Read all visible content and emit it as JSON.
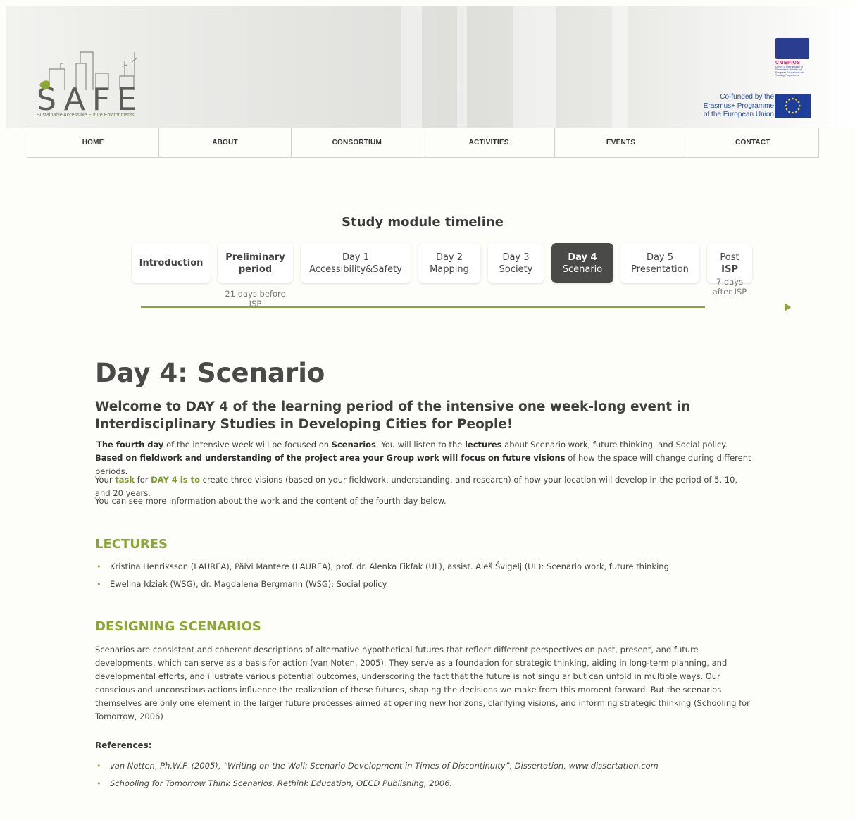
{
  "brand": {
    "logo_text": "SAFE",
    "logo_subtitle": "Sustainable  Accessible  Future  Environments",
    "cmepius_name": "CMEPIUS",
    "cmepius_desc": "Centre of the Republic of Slovenia for Mobility and European Educational and Training Programmes",
    "cofunded_line1": "Co-funded by the",
    "cofunded_line2": "Erasmus+ Programme",
    "cofunded_line3": "of the European Union"
  },
  "nav": {
    "items": [
      {
        "label": "HOME"
      },
      {
        "label": "ABOUT"
      },
      {
        "label": "CONSORTIUM"
      },
      {
        "label": "ACTIVITIES"
      },
      {
        "label": "EVENTS"
      },
      {
        "label": "CONTACT"
      }
    ]
  },
  "timeline": {
    "title": "Study module timeline",
    "steps": [
      {
        "line1": "Introduction",
        "line2": ""
      },
      {
        "line1": "Preliminary",
        "line2": "period"
      },
      {
        "line1": "Day 1",
        "line2": "Accessibility&Safety"
      },
      {
        "line1": "Day 2",
        "line2": "Mapping"
      },
      {
        "line1": "Day 3",
        "line2": "Society"
      },
      {
        "line1": "Day 4",
        "line2": "Scenario"
      },
      {
        "line1": "Day 5",
        "line2": "Presentation"
      },
      {
        "line1": "Post",
        "line2": "ISP"
      }
    ],
    "note_before": "21 days before ISP",
    "note_after_1": "7 days",
    "note_after_2": "after ISP"
  },
  "main": {
    "title": "Day 4: Scenario",
    "welcome": "Welcome to DAY 4 of the learning period of the intensive one week-long event in Interdisciplinary Studies in Developing Cities for People!",
    "intro": {
      "b1": "The fourth day",
      "t1": " of the intensive week will be focused on ",
      "b2": "Scenarios",
      "t2": ". You will listen to the ",
      "b3": "lectures",
      "t3": " about Scenario work, future thinking, and Social policy. ",
      "b4": "Based on fieldwork and understanding of the project area your Group work will focus on future visions",
      "t4": " of how the space will change during different periods."
    },
    "task": {
      "t1": "Your ",
      "g1": "task",
      "t2": " for ",
      "g2": "DAY 4 is to",
      "t3": " create three visions (based on your fieldwork, understanding, and research) of how your location will develop in the period of 5, 10, and 20 years."
    },
    "more_info": "You can see more information about the work and the content of the fourth day below.",
    "lectures_heading": "LECTURES",
    "lectures": [
      "Kristina Henriksson (LAUREA), Päivi Mantere (LAUREA), prof. dr. Alenka Fikfak (UL), assist. Aleš Švigelj (UL): Scenario work, future thinking",
      "Ewelina Idziak (WSG), dr. Magdalena Bergmann (WSG): Social policy"
    ],
    "designing_heading": "DESIGNING SCENARIOS",
    "designing_text": "Scenarios are consistent and coherent descriptions of alternative hypothetical futures that reflect different perspectives on past, present, and future developments, which can serve as a basis for action (van Noten, 2005). They serve as a foundation for strategic thinking, aiding in long-term planning, and developmental efforts, and illustrate various potential outcomes, underscoring the fact that the future is not singular but can unfold in multiple ways. Our conscious and unconscious actions influence the realization of these futures, shaping the decisions we make from this moment forward. But the scenarios themselves are only one element in the larger future processes aimed at opening new horizons, clarifying visions, and informing strategic thinking (Schooling for Tomorrow, 2006)",
    "references_heading": "References:",
    "references": [
      "van Notten, Ph.W.F. (2005), “Writing on the Wall: Scenario Development in Times of Discontinuity”, Dissertation, www.dissertation.com",
      "Schooling for Tomorrow Think Scenarios, Rethink Education, OECD Publishing, 2006."
    ]
  },
  "colors": {
    "accent_green": "#8aa734",
    "active_step": "#4a4a48",
    "eu_blue": "#1f3e9a"
  }
}
